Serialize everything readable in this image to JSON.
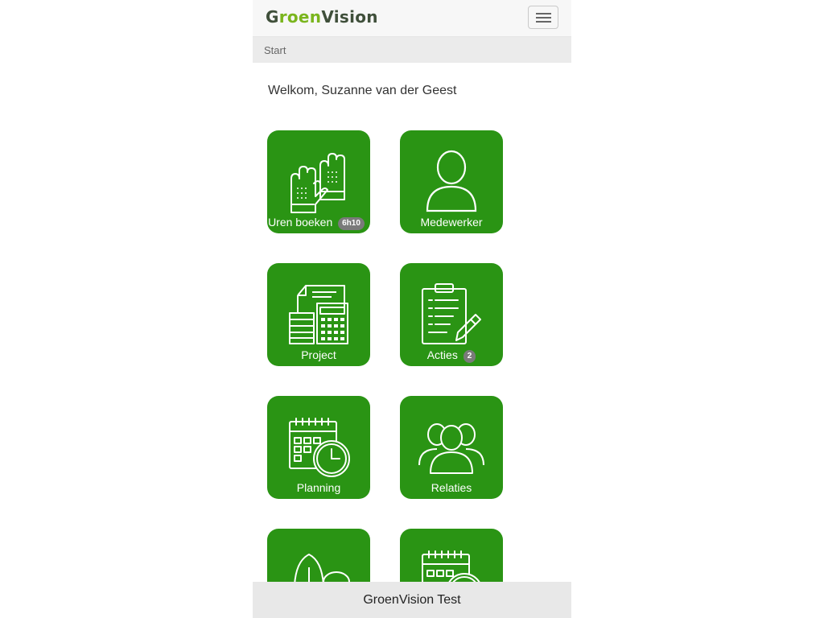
{
  "header": {
    "logo_part1": "G",
    "logo_part2": "roen",
    "logo_part3": "Vision",
    "menu_icon": "hamburger-icon"
  },
  "breadcrumb": {
    "current": "Start"
  },
  "welcome": "Welkom, Suzanne van der Geest",
  "tiles": [
    {
      "label": "Uren boeken",
      "badge": "6h10",
      "icon": "gloves-icon"
    },
    {
      "label": "Medewerker",
      "icon": "person-icon"
    },
    {
      "label": "Project",
      "icon": "documents-calculator-icon"
    },
    {
      "label": "Acties",
      "badge": "2",
      "icon": "clipboard-pencil-icon"
    },
    {
      "label": "Planning",
      "icon": "calendar-clock-icon"
    },
    {
      "label": "Relaties",
      "icon": "group-icon"
    },
    {
      "label": "",
      "icon": "trees-icon"
    },
    {
      "label": "",
      "icon": "calendar-clock-icon"
    }
  ],
  "footer": {
    "title": "GroenVision Test"
  },
  "colors": {
    "tile": "#2a9414",
    "logo_green": "#7ab51d",
    "logo_dark": "#3f4f3a",
    "badge": "#7a7a7a"
  }
}
